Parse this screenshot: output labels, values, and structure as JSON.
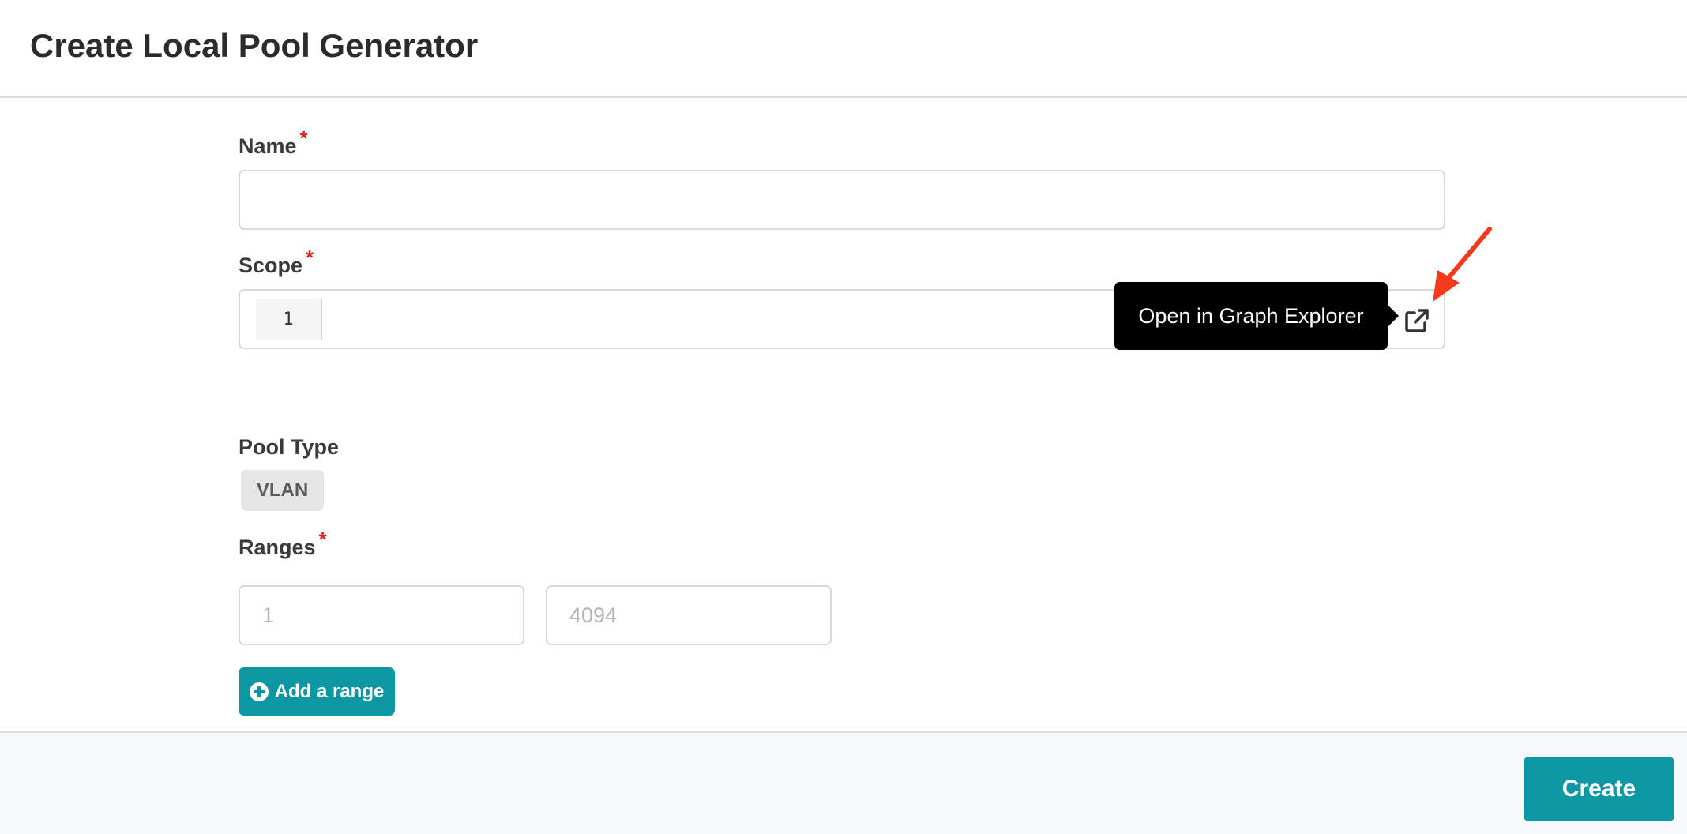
{
  "header": {
    "title": "Create Local Pool Generator"
  },
  "form": {
    "name": {
      "label": "Name",
      "required_mark": "*",
      "value": ""
    },
    "scope": {
      "label": "Scope",
      "required_mark": "*",
      "line_number": "1",
      "open_icon": "external-link-icon",
      "tooltip": "Open in Graph Explorer"
    },
    "pool_type": {
      "label": "Pool Type",
      "value": "VLAN"
    },
    "ranges": {
      "label": "Ranges",
      "required_mark": "*",
      "items": [
        {
          "start_placeholder": "1",
          "end_placeholder": "4094"
        }
      ],
      "add_label": "Add a range"
    }
  },
  "footer": {
    "create_label": "Create"
  },
  "colors": {
    "accent": "#0c97a2",
    "required": "#e02020",
    "annotation_arrow": "#f43a1a"
  }
}
